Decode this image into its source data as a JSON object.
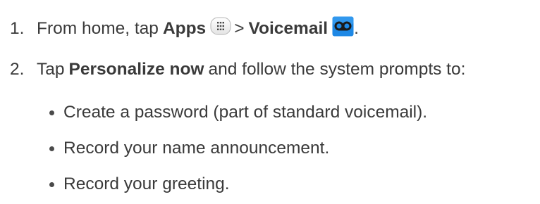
{
  "steps": [
    {
      "number": "1.",
      "prefix": "From home, tap",
      "apps_label": "Apps",
      "separator": ">",
      "voicemail_label": "Voicemail",
      "suffix": ".",
      "apps_icon": "apps-grid-icon",
      "voicemail_icon": "voicemail-icon"
    },
    {
      "number": "2.",
      "prefix": "Tap",
      "bold_label": "Personalize now",
      "suffix": "and follow the system prompts to:"
    }
  ],
  "bullets": [
    "Create a password (part of standard voicemail).",
    "Record your name announcement.",
    "Record your greeting."
  ],
  "colors": {
    "text": "#3a3a3a",
    "voicemail_icon_bg": "#1e88e5"
  }
}
